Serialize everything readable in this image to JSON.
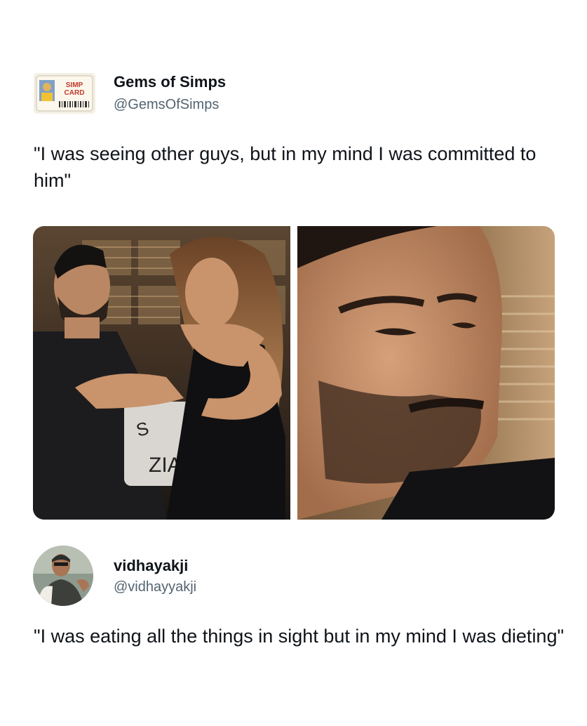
{
  "tweet1": {
    "display_name": "Gems of Simps",
    "handle": "@GemsOfSimps",
    "avatar_text": "SIMP CARD",
    "text": "\"I was seeing other guys, but in my mind I was committed to him\"",
    "photos": [
      {
        "subject": "couple seated on talk-show couch"
      },
      {
        "subject": "close-up of bearded man"
      }
    ]
  },
  "tweet2": {
    "display_name": "vidhayakji",
    "handle": "@vidhayyakji",
    "text": "\"I was eating all the things in sight but in my mind I was dieting\""
  },
  "colors": {
    "text_primary": "#0f1419",
    "text_secondary": "#536471",
    "background": "#ffffff"
  }
}
